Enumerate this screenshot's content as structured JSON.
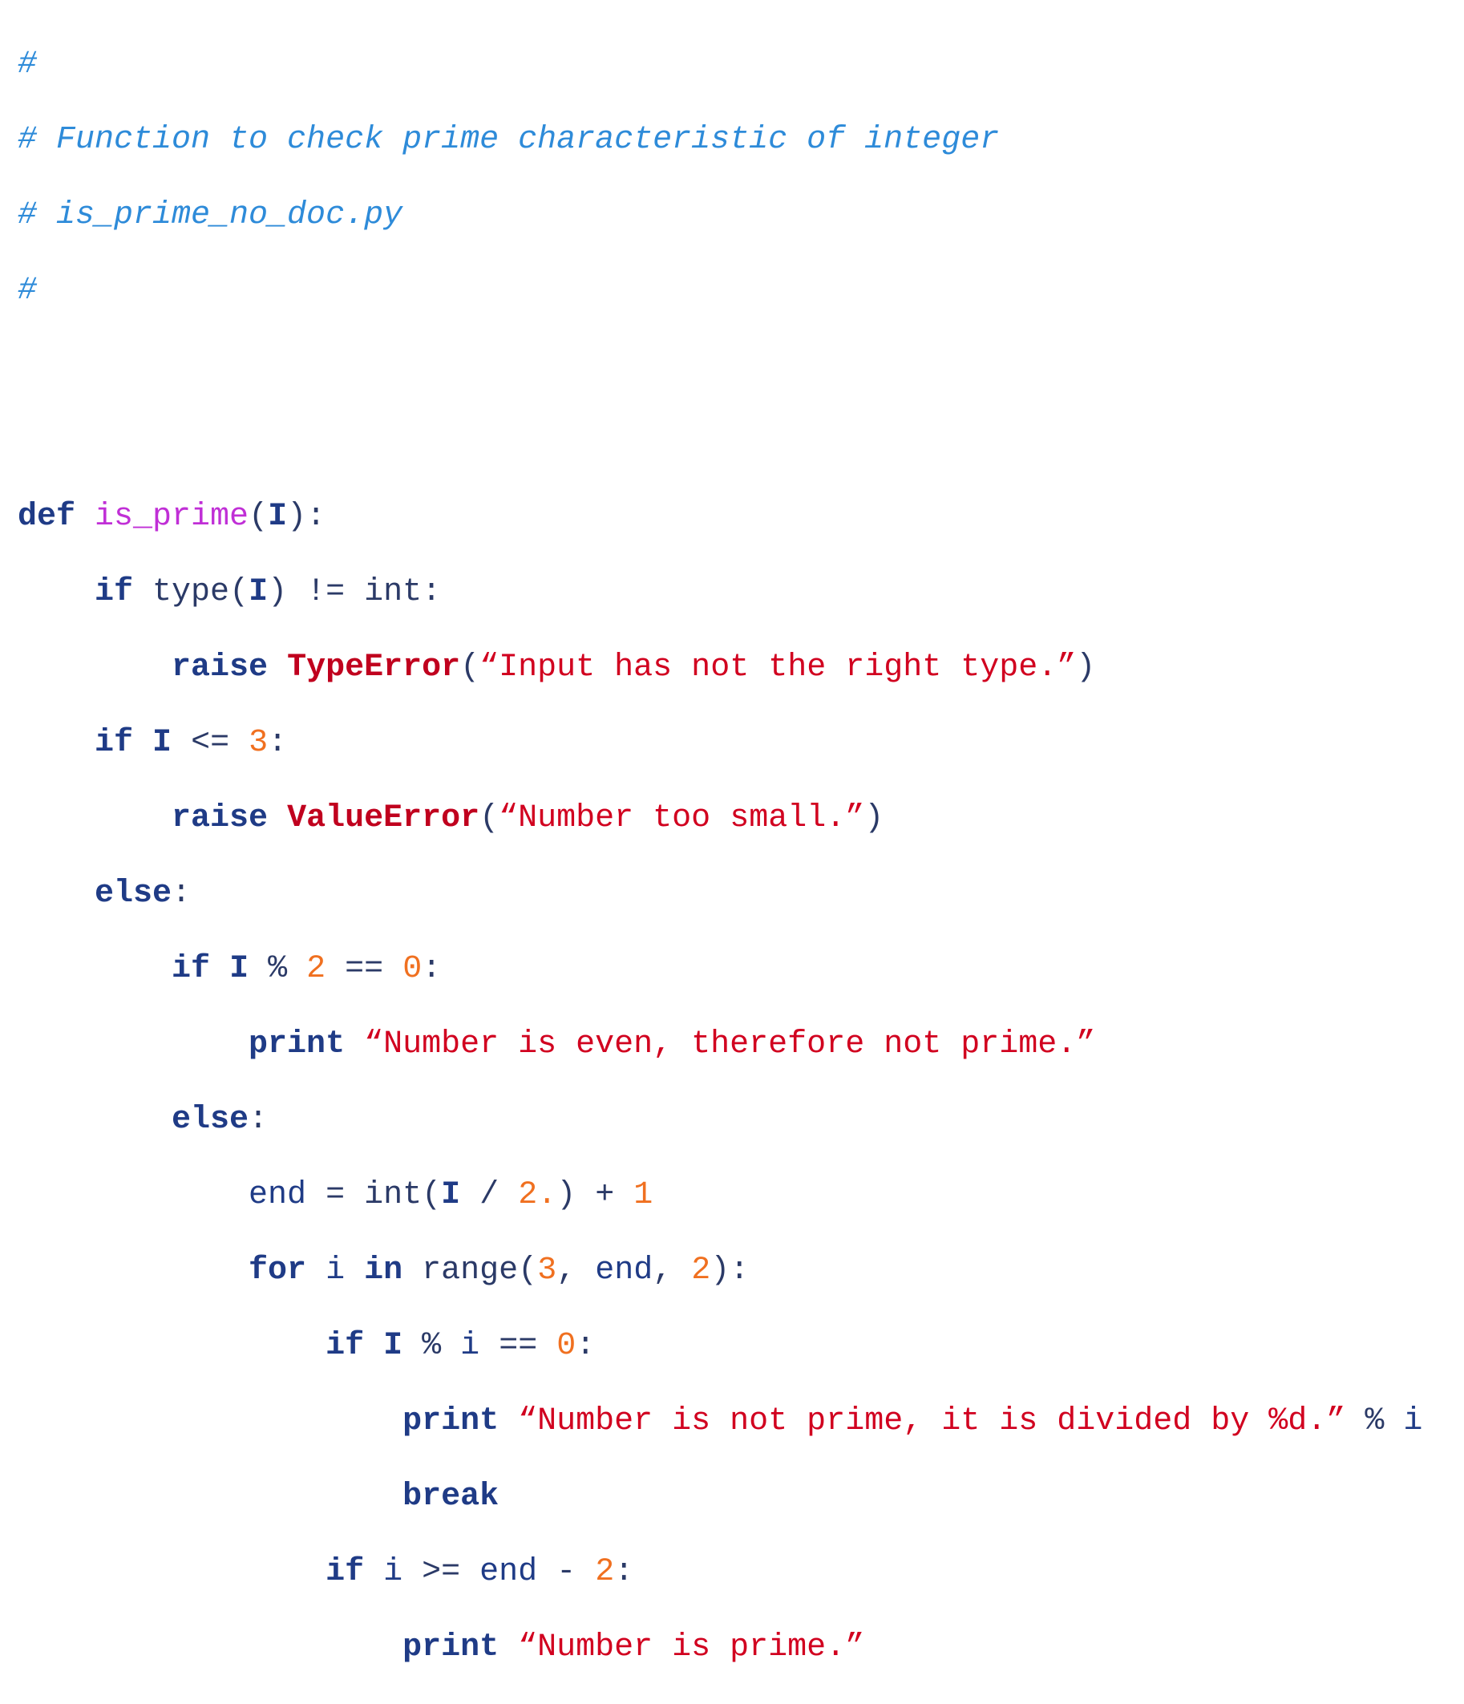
{
  "code": {
    "language": "python",
    "comment_lines": [
      "#",
      "# Function to check prime characteristic of integer",
      "# is_prime_no_doc.py",
      "#"
    ],
    "def_keyword": "def",
    "function_name": "is_prime",
    "param": "I",
    "keywords": {
      "if": "if",
      "raise": "raise",
      "else": "else",
      "print": "print",
      "for": "for",
      "in": "in",
      "break": "break"
    },
    "builtins": {
      "type": "type",
      "int": "int",
      "range": "range"
    },
    "exceptions": {
      "type_error": "TypeError",
      "value_error": "ValueError"
    },
    "strings": {
      "type_msg": "“Input has not the right type.”",
      "small_msg": "“Number too small.”",
      "even_msg": "“Number is even, therefore not prime.”",
      "divided_msg": "“Number is not prime, it is divided by %d.”",
      "prime_msg": "“Number is prime.”"
    },
    "numbers": {
      "three": "3",
      "two": "2",
      "zero": "0",
      "two_float": "2.",
      "one": "1"
    },
    "identifiers": {
      "end": "end",
      "i": "i"
    }
  }
}
